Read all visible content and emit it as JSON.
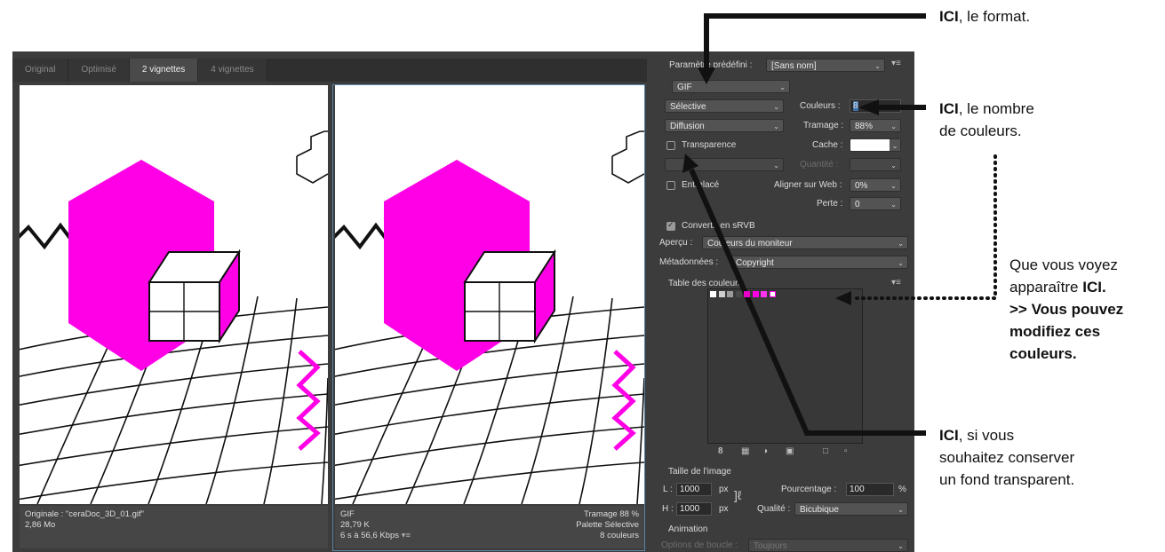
{
  "tabs": [
    {
      "label": "Original",
      "active": false
    },
    {
      "label": "Optimisé",
      "active": false
    },
    {
      "label": "2 vignettes",
      "active": true
    },
    {
      "label": "4 vignettes",
      "active": false
    }
  ],
  "left_info": {
    "line1": "Originale : \"ceraDoc_3D_01.gif\"",
    "line2": "2,86 Mo"
  },
  "right_info": {
    "format": "GIF",
    "size": "28,79 K",
    "speed": "6 s à 56,6 Kbps",
    "dither": "Tramage 88 %",
    "palette": "Palette Sélective",
    "colors": "8 couleurs"
  },
  "settings": {
    "preset_label": "Paramètre prédéfini :",
    "preset_value": "[Sans nom]",
    "format_value": "GIF",
    "reduction_value": "Sélective",
    "colors_label": "Couleurs :",
    "colors_value": "8",
    "dither_value": "Diffusion",
    "dither_amount_label": "Tramage :",
    "dither_amount_value": "88%",
    "transparency_label": "Transparence",
    "matte_label": "Cache :",
    "amount_label": "Quantité :",
    "interlaced_label": "Entrelacé",
    "web_snap_label": "Aligner sur Web :",
    "web_snap_value": "0%",
    "lossy_label": "Perte :",
    "lossy_value": "0",
    "srgb_label": "Convertir en sRVB",
    "preview_label": "Aperçu :",
    "preview_value": "Couleurs du moniteur",
    "metadata_label": "Métadonnées :",
    "metadata_value": "Copyright",
    "color_table_label": "Table des couleurs",
    "color_count": "8",
    "image_size_label": "Taille de l'image",
    "width_label": "L :",
    "width_value": "1000",
    "height_label": "H :",
    "height_value": "1000",
    "unit": "px",
    "percent_label": "Pourcentage :",
    "percent_value": "100",
    "percent_unit": "%",
    "quality_label": "Qualité :",
    "quality_value": "Bicubique",
    "animation_label": "Animation",
    "loop_label": "Options de boucle :",
    "loop_value": "Toujours"
  },
  "swatches": [
    "#ffffff",
    "#cfcfcf",
    "#9b9b9b",
    "#4a4a4a",
    "#e600c8",
    "#ff00e6",
    "#ff33ee",
    "#ffffff"
  ],
  "annotations": {
    "a1_bold": "ICI",
    "a1_text": ", le format.",
    "a2_bold": "ICI",
    "a2_line1": ", le nombre",
    "a2_line2": "de couleurs.",
    "a3_line1": "Que vous voyez",
    "a3_line2": "apparaître ",
    "a3_bold": "ICI.",
    "a3_line3": ">> Vous pouvez",
    "a3_line4": "modifiez ces",
    "a3_line5": "couleurs.",
    "a4_bold": "ICI",
    "a4_line1": ", si vous",
    "a4_line2": "souhaitez conserver",
    "a4_line3": "un fond transparent."
  },
  "colors": {
    "accent_magenta": "#ff00e6",
    "panel": "#3c3c3c",
    "frame": "#5b86a8"
  }
}
